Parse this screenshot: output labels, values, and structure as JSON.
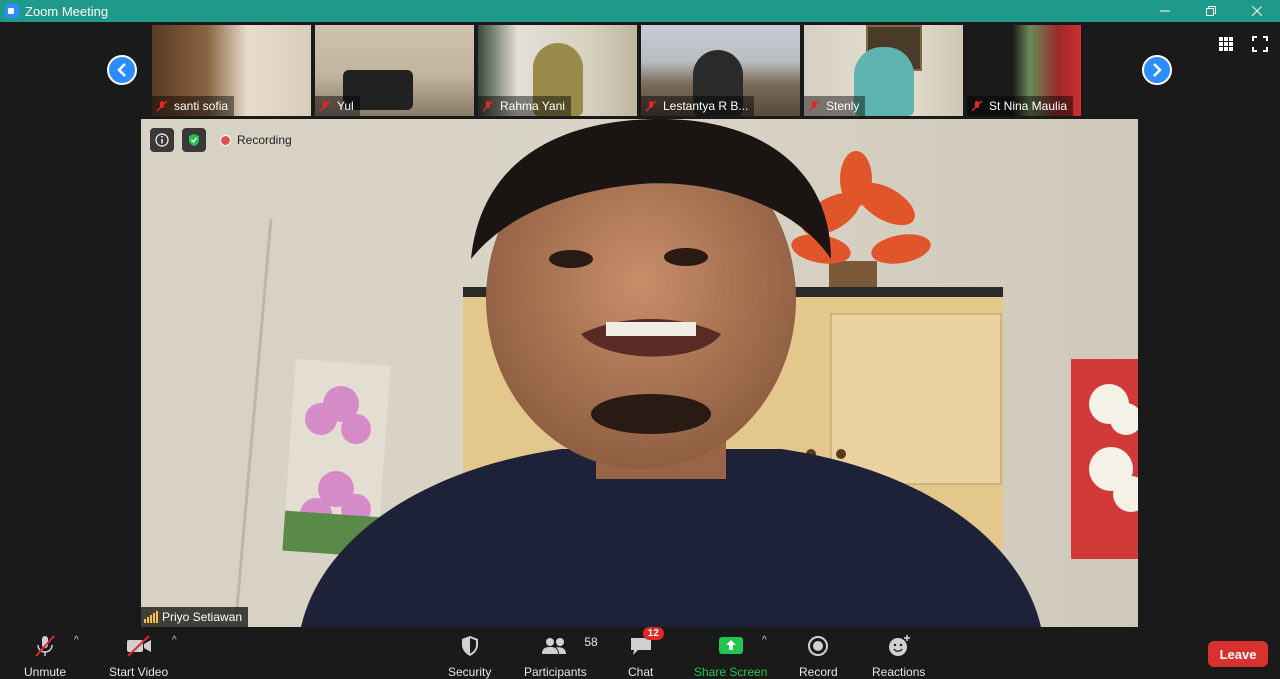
{
  "window": {
    "title": "Zoom Meeting",
    "controls": [
      "minimize-icon",
      "restore-icon",
      "close-icon"
    ]
  },
  "gallery_strip": {
    "participants": [
      {
        "name": "santi sofia",
        "muted": true
      },
      {
        "name": "Yul",
        "muted": true
      },
      {
        "name": "Rahma Yani",
        "muted": true
      },
      {
        "name": "Lestantya R B...",
        "muted": true
      },
      {
        "name": "Stenly",
        "muted": true
      },
      {
        "name": "St Nina Maulia",
        "muted": true
      }
    ],
    "prev_icon": "chevron-left-icon",
    "next_icon": "chevron-right-icon"
  },
  "view_controls": [
    "gallery-view-icon",
    "fullscreen-icon"
  ],
  "main_video": {
    "speaker_name": "Priyo Setiawan",
    "recording_label": "Recording"
  },
  "toolbar": {
    "unmute": "Unmute",
    "start_video": "Start Video",
    "security": "Security",
    "participants": "Participants",
    "participants_count": "58",
    "chat": "Chat",
    "chat_badge": "12",
    "share_screen": "Share Screen",
    "record": "Record",
    "reactions": "Reactions",
    "leave": "Leave"
  },
  "colors": {
    "titlebar": "#1f9a8a",
    "accent": "#2d8cff",
    "share_green": "#23c552",
    "leave_red": "#d9312e",
    "recording_red": "#e0524c"
  }
}
